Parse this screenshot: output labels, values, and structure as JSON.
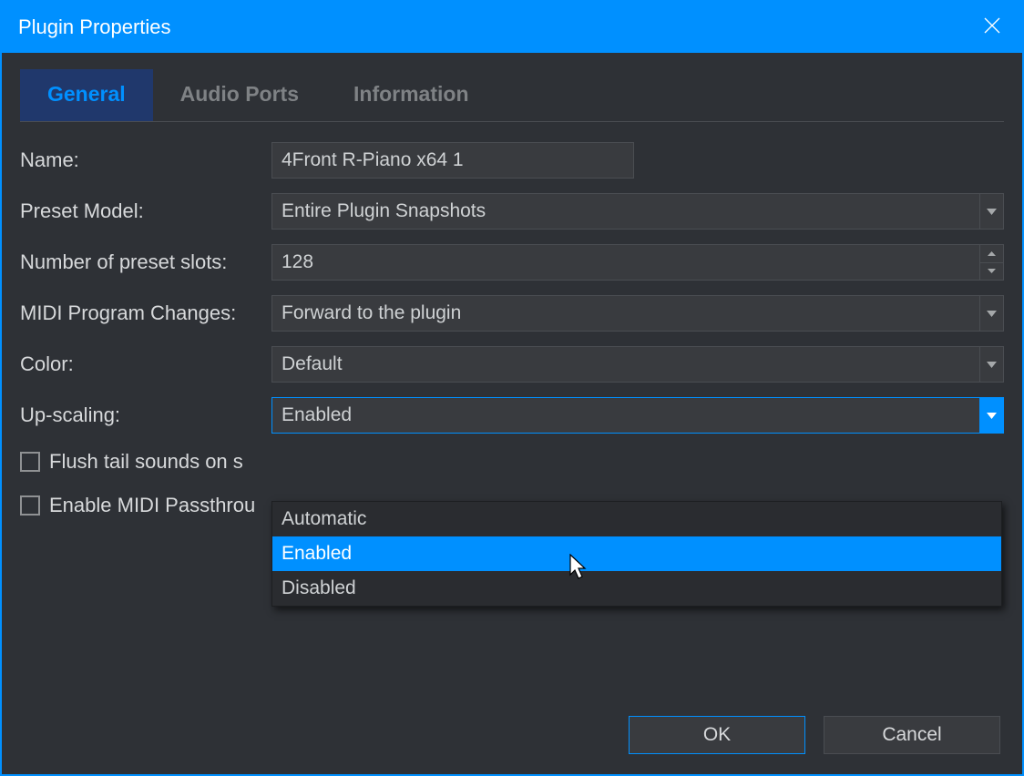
{
  "window": {
    "title": "Plugin Properties"
  },
  "tabs": [
    "General",
    "Audio Ports",
    "Information"
  ],
  "active_tab": 0,
  "fields": {
    "name": {
      "label": "Name:",
      "value": "4Front R-Piano x64 1"
    },
    "preset_model": {
      "label": "Preset Model:",
      "value": "Entire Plugin Snapshots"
    },
    "slots": {
      "label": "Number of preset slots:",
      "value": "128"
    },
    "midi_pc": {
      "label": "MIDI Program Changes:",
      "value": "Forward to the plugin"
    },
    "color": {
      "label": "Color:",
      "value": "Default"
    },
    "upscaling": {
      "label": "Up-scaling:",
      "value": "Enabled"
    }
  },
  "upscaling_options": [
    "Automatic",
    "Enabled",
    "Disabled"
  ],
  "upscaling_hover_index": 1,
  "checks": {
    "flush": {
      "label": "Flush tail sounds on s",
      "checked": false
    },
    "passthrough": {
      "label": "Enable MIDI Passthrou",
      "checked": false
    }
  },
  "buttons": {
    "ok": "OK",
    "cancel": "Cancel"
  }
}
